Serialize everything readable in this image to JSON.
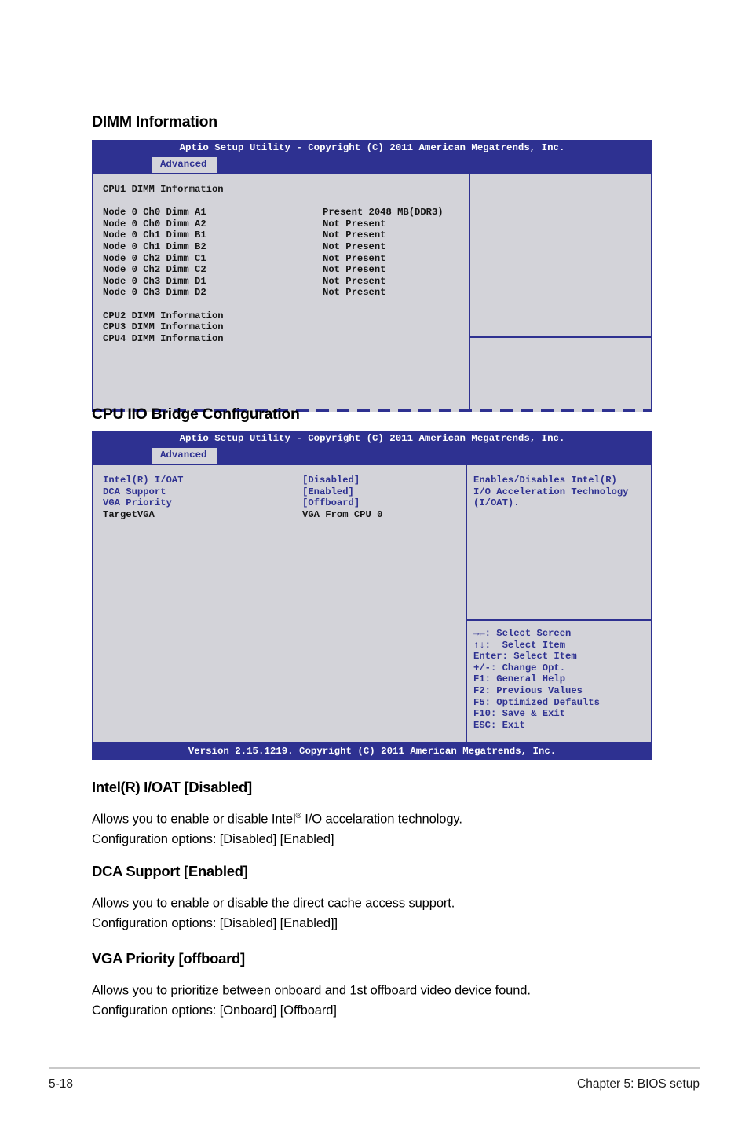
{
  "sections": {
    "dimm_heading": "DIMM Information",
    "iio_heading": "CPU IIO Bridge Configuration"
  },
  "bios_common": {
    "title": "Aptio Setup Utility - Copyright (C) 2011 American Megatrends, Inc.",
    "tab": "Advanced",
    "version_footer": "Version 2.15.1219. Copyright (C) 2011 American Megatrends, Inc."
  },
  "bios_dimm": {
    "section_label": "CPU1 DIMM Information",
    "dimms": [
      {
        "label": "Node 0 Ch0 Dimm A1",
        "value": "Present 2048 MB(DDR3)"
      },
      {
        "label": "Node 0 Ch0 Dimm A2",
        "value": "Not Present"
      },
      {
        "label": "Node 0 Ch1 Dimm B1",
        "value": "Not Present"
      },
      {
        "label": "Node 0 Ch1 Dimm B2",
        "value": "Not Present"
      },
      {
        "label": "Node 0 Ch2 Dimm C1",
        "value": "Not Present"
      },
      {
        "label": "Node 0 Ch2 Dimm C2",
        "value": "Not Present"
      },
      {
        "label": "Node 0 Ch3 Dimm D1",
        "value": "Not Present"
      },
      {
        "label": "Node 0 Ch3 Dimm D2",
        "value": "Not Present"
      }
    ],
    "submenus": [
      "CPU2 DIMM Information",
      "CPU3 DIMM Information",
      "CPU4 DIMM Information"
    ]
  },
  "bios_iio": {
    "items": [
      {
        "label": "Intel(R) I/OAT",
        "value": "[Disabled]",
        "style": "blue"
      },
      {
        "label": "DCA Support",
        "value": "[Enabled]",
        "style": "blue"
      },
      {
        "label": "VGA Priority",
        "value": "[Offboard]",
        "style": "blue"
      },
      {
        "label": "TargetVGA",
        "value": "VGA From CPU 0",
        "style": "dark"
      }
    ],
    "help_lines": [
      "Enables/Disables Intel(R)",
      "I/O Acceleration Technology",
      "(I/OAT)."
    ],
    "nav_keys": [
      "→←: Select Screen",
      "↑↓:  Select Item",
      "Enter: Select Item",
      "+/-: Change Opt.",
      "F1: General Help",
      "F2: Previous Values",
      "F5: Optimized Defaults",
      "F10: Save & Exit",
      "ESC: Exit"
    ]
  },
  "descriptions": [
    {
      "title": "Intel(R) I/OAT [Disabled]",
      "line1_pre": "Allows you to enable or disable Intel",
      "line1_sup": "®",
      "line1_post": " I/O accelaration technology.",
      "line2": "Configuration options: [Disabled] [Enabled]"
    },
    {
      "title": "DCA Support [Enabled]",
      "line1_pre": "Allows you to enable or disable the direct cache access support.",
      "line1_sup": "",
      "line1_post": "",
      "line2": "Configuration options: [Disabled] [Enabled]]"
    },
    {
      "title": "VGA Priority [offboard]",
      "line1_pre": "Allows you to prioritize between onboard and 1st offboard video device found.",
      "line1_sup": "",
      "line1_post": "",
      "line2": "Configuration options: [Onboard] [Offboard]"
    }
  ],
  "page_footer": {
    "page_number": "5-18",
    "chapter": "Chapter 5: BIOS setup"
  },
  "colors": {
    "bios_blue": "#2e3191",
    "bios_panel_gray": "#d3d3d9",
    "tab_gray": "#d4d4da"
  }
}
